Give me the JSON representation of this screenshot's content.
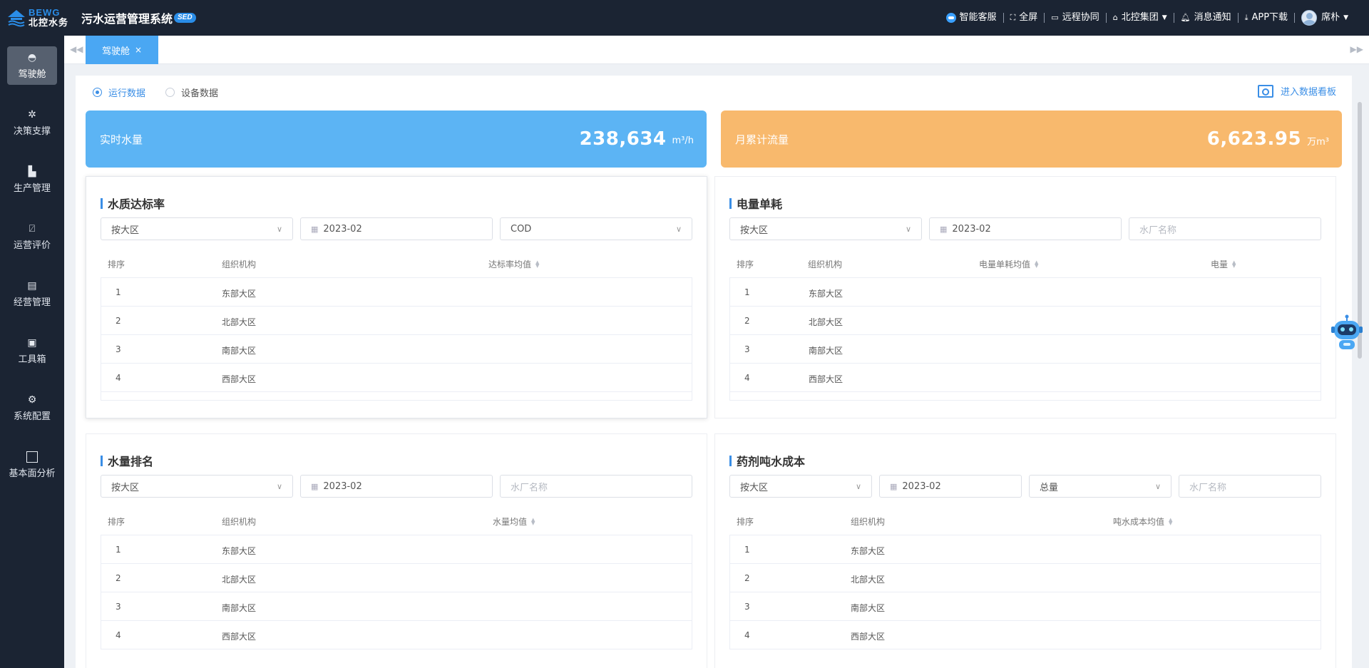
{
  "header": {
    "logo_en": "BEWG",
    "logo_cn": "北控水务",
    "system_title": "污水运营管理系统",
    "badge": "SED",
    "items": [
      {
        "label": "智能客服",
        "icon": "chat-bubble-icon"
      },
      {
        "label": "全屏",
        "icon": "fullscreen-icon"
      },
      {
        "label": "远程协同",
        "icon": "remote-screen-icon"
      },
      {
        "label": "北控集团",
        "icon": "home-icon"
      },
      {
        "label": "消息通知",
        "icon": "bell-icon"
      },
      {
        "label": "APP下载",
        "icon": "download-icon"
      },
      {
        "label": "席朴",
        "icon": "avatar"
      }
    ]
  },
  "sidebar": {
    "items": [
      {
        "label": "驾驶舱",
        "icon": "dashboard-gauge-icon"
      },
      {
        "label": "决策支撑",
        "icon": "network-icon"
      },
      {
        "label": "生产管理",
        "icon": "factory-icon"
      },
      {
        "label": "运营评价",
        "icon": "chart-icon"
      },
      {
        "label": "经营管理",
        "icon": "briefcase-icon"
      },
      {
        "label": "工具箱",
        "icon": "toolbox-icon"
      },
      {
        "label": "系统配置",
        "icon": "settings-icon"
      },
      {
        "label": "基本面分析",
        "icon": "square-icon"
      }
    ]
  },
  "tabs": [
    {
      "label": "驾驶舱",
      "close": "×"
    }
  ],
  "toggle": {
    "options": [
      "运行数据",
      "设备数据"
    ],
    "selected": "运行数据"
  },
  "dashboard_link": "进入数据看板",
  "kpi": {
    "realtime": {
      "label": "实时水量",
      "value": "238,634",
      "unit": "m³/h",
      "color": "#5cb4f4"
    },
    "monthly": {
      "label": "月累计流量",
      "value": "6,623.95",
      "unit": "万m³",
      "color": "#f8b96d"
    }
  },
  "cards": {
    "quality": {
      "title": "水质达标率",
      "filters": {
        "region": "按大区",
        "month": "2023-02",
        "indicator": "COD"
      },
      "columns": [
        "排序",
        "组织机构",
        "达标率均值"
      ],
      "rows": [
        [
          "1",
          "东部大区"
        ],
        [
          "2",
          "北部大区"
        ],
        [
          "3",
          "南部大区"
        ],
        [
          "4",
          "西部大区"
        ]
      ]
    },
    "power": {
      "title": "电量单耗",
      "filters": {
        "region": "按大区",
        "month": "2023-02",
        "plant_placeholder": "水厂名称"
      },
      "columns": [
        "排序",
        "组织机构",
        "电量单耗均值",
        "电量"
      ],
      "rows": [
        [
          "1",
          "东部大区"
        ],
        [
          "2",
          "北部大区"
        ],
        [
          "3",
          "南部大区"
        ],
        [
          "4",
          "西部大区"
        ]
      ]
    },
    "volume": {
      "title": "水量排名",
      "filters": {
        "region": "按大区",
        "month": "2023-02",
        "plant_placeholder": "水厂名称"
      },
      "columns": [
        "排序",
        "组织机构",
        "水量均值"
      ],
      "rows": [
        [
          "1",
          "东部大区"
        ],
        [
          "2",
          "北部大区"
        ],
        [
          "3",
          "南部大区"
        ],
        [
          "4",
          "西部大区"
        ]
      ]
    },
    "chemical": {
      "title": "药剂吨水成本",
      "filters": {
        "region": "按大区",
        "month": "2023-02",
        "type": "总量",
        "plant_placeholder": "水厂名称"
      },
      "columns": [
        "排序",
        "组织机构",
        "吨水成本均值"
      ],
      "rows": [
        [
          "1",
          "东部大区"
        ],
        [
          "2",
          "北部大区"
        ],
        [
          "3",
          "南部大区"
        ],
        [
          "4",
          "西部大区"
        ]
      ]
    }
  }
}
